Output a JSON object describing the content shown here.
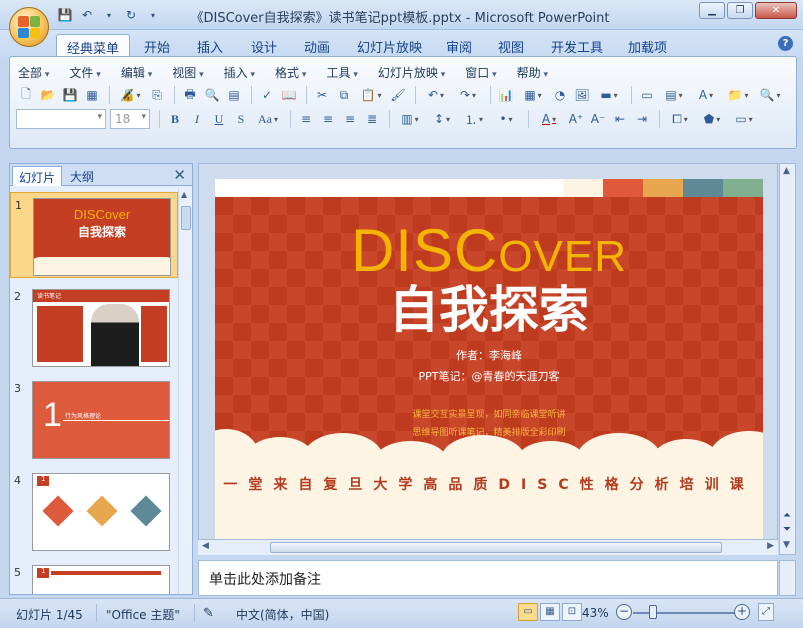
{
  "window": {
    "title": "《DISCover自我探索》读书笔记ppt模板.pptx - Microsoft PowerPoint",
    "minimize": "▁",
    "maximize": "❐",
    "close": "✕"
  },
  "quick_access": {
    "save_icon": "save-icon",
    "undo_icon": "undo-icon",
    "redo_icon": "redo-icon"
  },
  "ribbon_tabs": [
    "经典菜单",
    "开始",
    "插入",
    "设计",
    "动画",
    "幻灯片放映",
    "审阅",
    "视图",
    "开发工具",
    "加载项"
  ],
  "classic_menus": [
    "全部",
    "文件",
    "编辑",
    "视图",
    "插入",
    "格式",
    "工具",
    "幻灯片放映",
    "窗口",
    "帮助"
  ],
  "font": {
    "size": "18"
  },
  "left_panel": {
    "tab_slides": "幻灯片",
    "tab_outline": "大纲",
    "close": "✕",
    "thumbnails": [
      {
        "num": "1",
        "title": "DISCover",
        "subtitle": "自我探索"
      },
      {
        "num": "2",
        "title": "读书笔记"
      },
      {
        "num": "3",
        "title": "1",
        "subtitle": "行为风格理论"
      },
      {
        "num": "4",
        "title": "1"
      },
      {
        "num": "5",
        "title": "1"
      }
    ]
  },
  "slide": {
    "title_big": "DISC",
    "title_small": "OVER",
    "title_cn": "自我探索",
    "author": "作者：李海峰",
    "notes_by": "PPT笔记：@青春的天涯刀客",
    "desc1": "课堂交互实景呈现，如同亲临课堂听讲",
    "desc2": "思维导图听课笔记，精美排版全彩印刷",
    "tagline": "一堂来自复旦大学高品质DISC性格分析培训课",
    "swatch_colors": [
      "#fdf4e3",
      "#e0593a",
      "#e8a74f",
      "#5e8a98",
      "#7faf8e"
    ]
  },
  "notes": {
    "placeholder": "单击此处添加备注"
  },
  "status": {
    "slide_counter": "幻灯片 1/45",
    "theme": "\"Office 主题\"",
    "language": "中文(简体，中国)",
    "zoom": "43%",
    "zoom_fraction": 0.43
  },
  "colors": {
    "slide_red": "#c33e22",
    "title_yellow": "#f5b400",
    "cream": "#fdf4e3"
  }
}
